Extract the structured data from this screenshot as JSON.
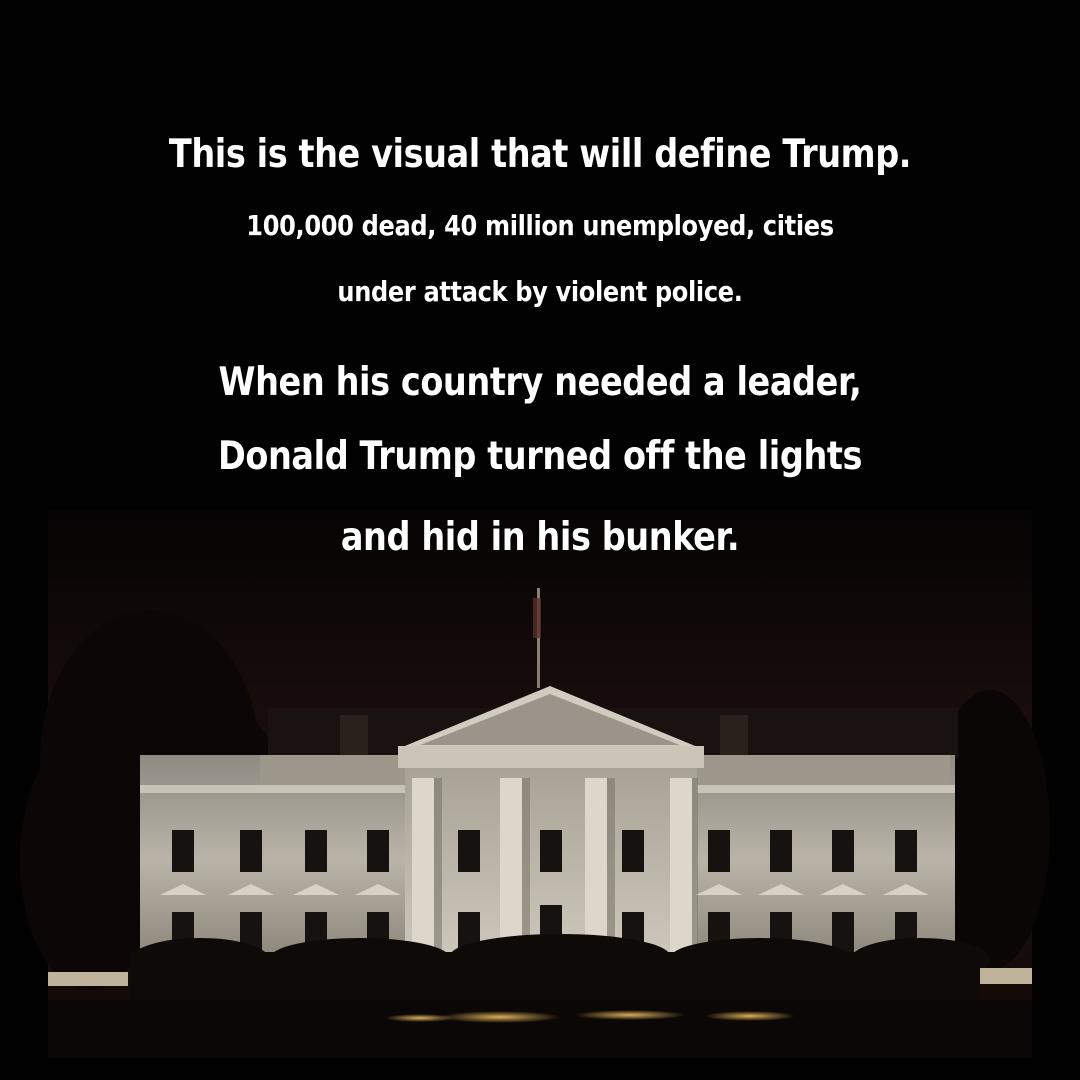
{
  "caption": {
    "headline": "This is the visual that will define Trump.",
    "subline_1": "100,000 dead, 40 million unemployed, cities",
    "subline_2": "under attack by violent police.",
    "main_line_1": "When his country needed a leader,",
    "main_line_2": "Donald Trump turned off the lights",
    "main_line_3": "and hid in his bunker."
  },
  "scene": {
    "subject": "white-house-at-night",
    "colors": {
      "background": "#020202",
      "sky": "#1a0e0c",
      "building_lit": "#bfb9ae",
      "building_shadow": "#6e6a63",
      "window": "#141210",
      "lamp_glow": "#d9a84a"
    }
  }
}
